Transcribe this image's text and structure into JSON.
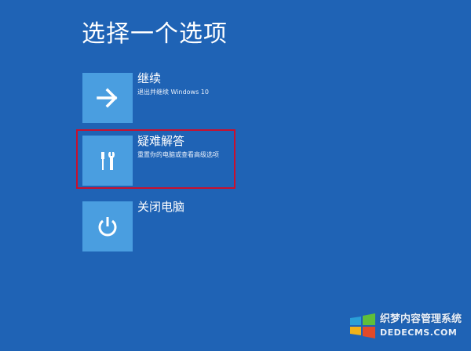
{
  "page": {
    "title": "选择一个选项"
  },
  "options": [
    {
      "id": "continue",
      "label": "继续",
      "description": "退出并继续 Windows 10",
      "icon": "arrow-right-icon"
    },
    {
      "id": "troubleshoot",
      "label": "疑难解答",
      "description": "重置你的电脑或查看高级选项",
      "icon": "tools-icon",
      "highlighted": true
    },
    {
      "id": "shutdown",
      "label": "关闭电脑",
      "description": "",
      "icon": "power-icon"
    }
  ],
  "watermark": {
    "line1": "织梦内容管理系统",
    "line2": "DEDECMS.COM",
    "icon": "windows-logo-icon"
  },
  "colors": {
    "background": "#1f63b5",
    "tile": "#4a9ee0",
    "highlight": "#c8102e"
  }
}
